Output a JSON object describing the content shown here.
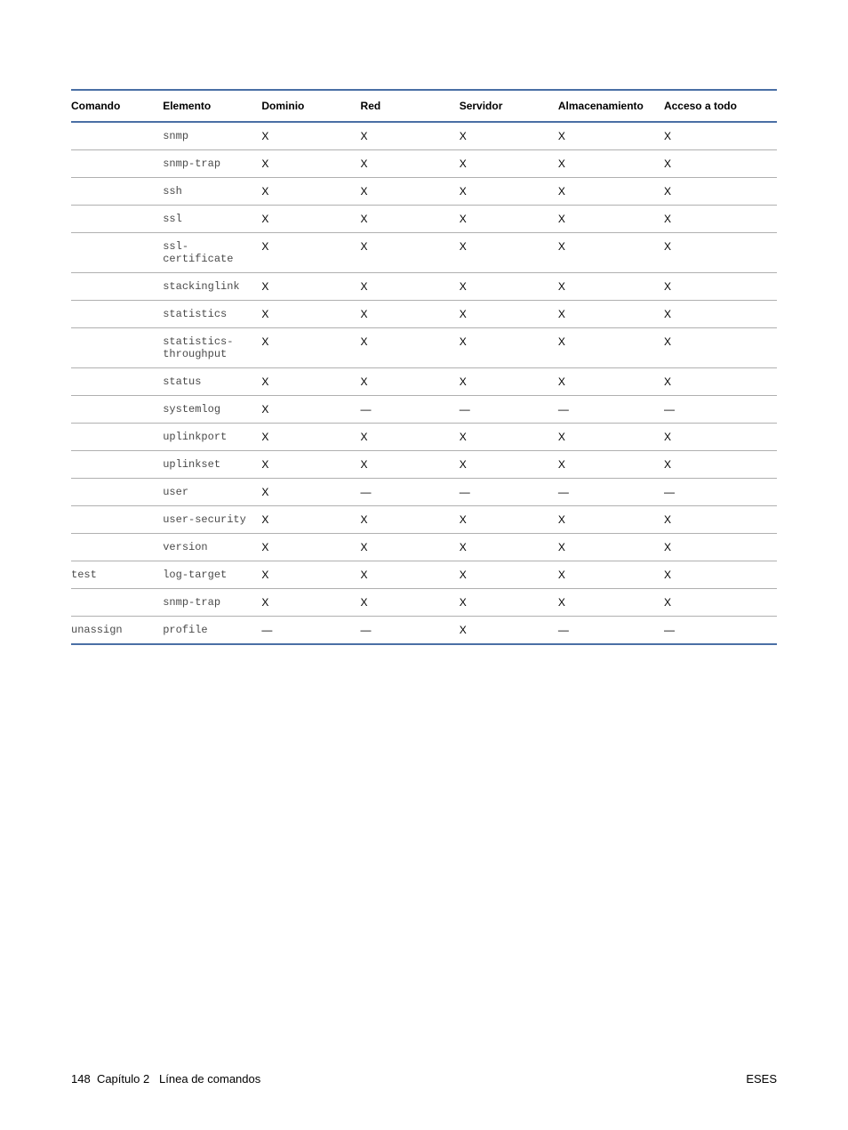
{
  "table": {
    "headers": {
      "comando": "Comando",
      "elemento": "Elemento",
      "dominio": "Dominio",
      "red": "Red",
      "servidor": "Servidor",
      "almacenamiento": "Almacenamiento",
      "acceso": "Acceso a todo"
    },
    "rows": [
      {
        "comando": "",
        "elemento": "snmp",
        "dominio": "X",
        "red": "X",
        "servidor": "X",
        "alm": "X",
        "acceso": "X"
      },
      {
        "comando": "",
        "elemento": "snmp-trap",
        "dominio": "X",
        "red": "X",
        "servidor": "X",
        "alm": "X",
        "acceso": "X"
      },
      {
        "comando": "",
        "elemento": "ssh",
        "dominio": "X",
        "red": "X",
        "servidor": "X",
        "alm": "X",
        "acceso": "X"
      },
      {
        "comando": "",
        "elemento": "ssl",
        "dominio": "X",
        "red": "X",
        "servidor": "X",
        "alm": "X",
        "acceso": "X"
      },
      {
        "comando": "",
        "elemento": "ssl-certificate",
        "dominio": "X",
        "red": "X",
        "servidor": "X",
        "alm": "X",
        "acceso": "X"
      },
      {
        "comando": "",
        "elemento": "stackinglink",
        "dominio": "X",
        "red": "X",
        "servidor": "X",
        "alm": "X",
        "acceso": "X"
      },
      {
        "comando": "",
        "elemento": "statistics",
        "dominio": "X",
        "red": "X",
        "servidor": "X",
        "alm": "X",
        "acceso": "X"
      },
      {
        "comando": "",
        "elemento": "statistics-throughput",
        "dominio": "X",
        "red": "X",
        "servidor": "X",
        "alm": "X",
        "acceso": "X"
      },
      {
        "comando": "",
        "elemento": "status",
        "dominio": "X",
        "red": "X",
        "servidor": "X",
        "alm": "X",
        "acceso": "X"
      },
      {
        "comando": "",
        "elemento": "systemlog",
        "dominio": "X",
        "red": "—",
        "servidor": "—",
        "alm": "—",
        "acceso": "—"
      },
      {
        "comando": "",
        "elemento": "uplinkport",
        "dominio": "X",
        "red": "X",
        "servidor": "X",
        "alm": "X",
        "acceso": "X"
      },
      {
        "comando": "",
        "elemento": "uplinkset",
        "dominio": "X",
        "red": "X",
        "servidor": "X",
        "alm": "X",
        "acceso": "X"
      },
      {
        "comando": "",
        "elemento": "user",
        "dominio": "X",
        "red": "—",
        "servidor": "—",
        "alm": "—",
        "acceso": "—"
      },
      {
        "comando": "",
        "elemento": "user-security",
        "dominio": "X",
        "red": "X",
        "servidor": "X",
        "alm": "X",
        "acceso": "X"
      },
      {
        "comando": "",
        "elemento": "version",
        "dominio": "X",
        "red": "X",
        "servidor": "X",
        "alm": "X",
        "acceso": "X"
      },
      {
        "comando": "test",
        "elemento": "log-target",
        "dominio": "X",
        "red": "X",
        "servidor": "X",
        "alm": "X",
        "acceso": "X"
      },
      {
        "comando": "",
        "elemento": "snmp-trap",
        "dominio": "X",
        "red": "X",
        "servidor": "X",
        "alm": "X",
        "acceso": "X"
      },
      {
        "comando": "unassign",
        "elemento": "profile",
        "dominio": "—",
        "red": "—",
        "servidor": "X",
        "alm": "—",
        "acceso": "—"
      }
    ]
  },
  "footer": {
    "page": "148",
    "chapter": "Capítulo 2",
    "section": "Línea de comandos",
    "lang": "ESES"
  }
}
